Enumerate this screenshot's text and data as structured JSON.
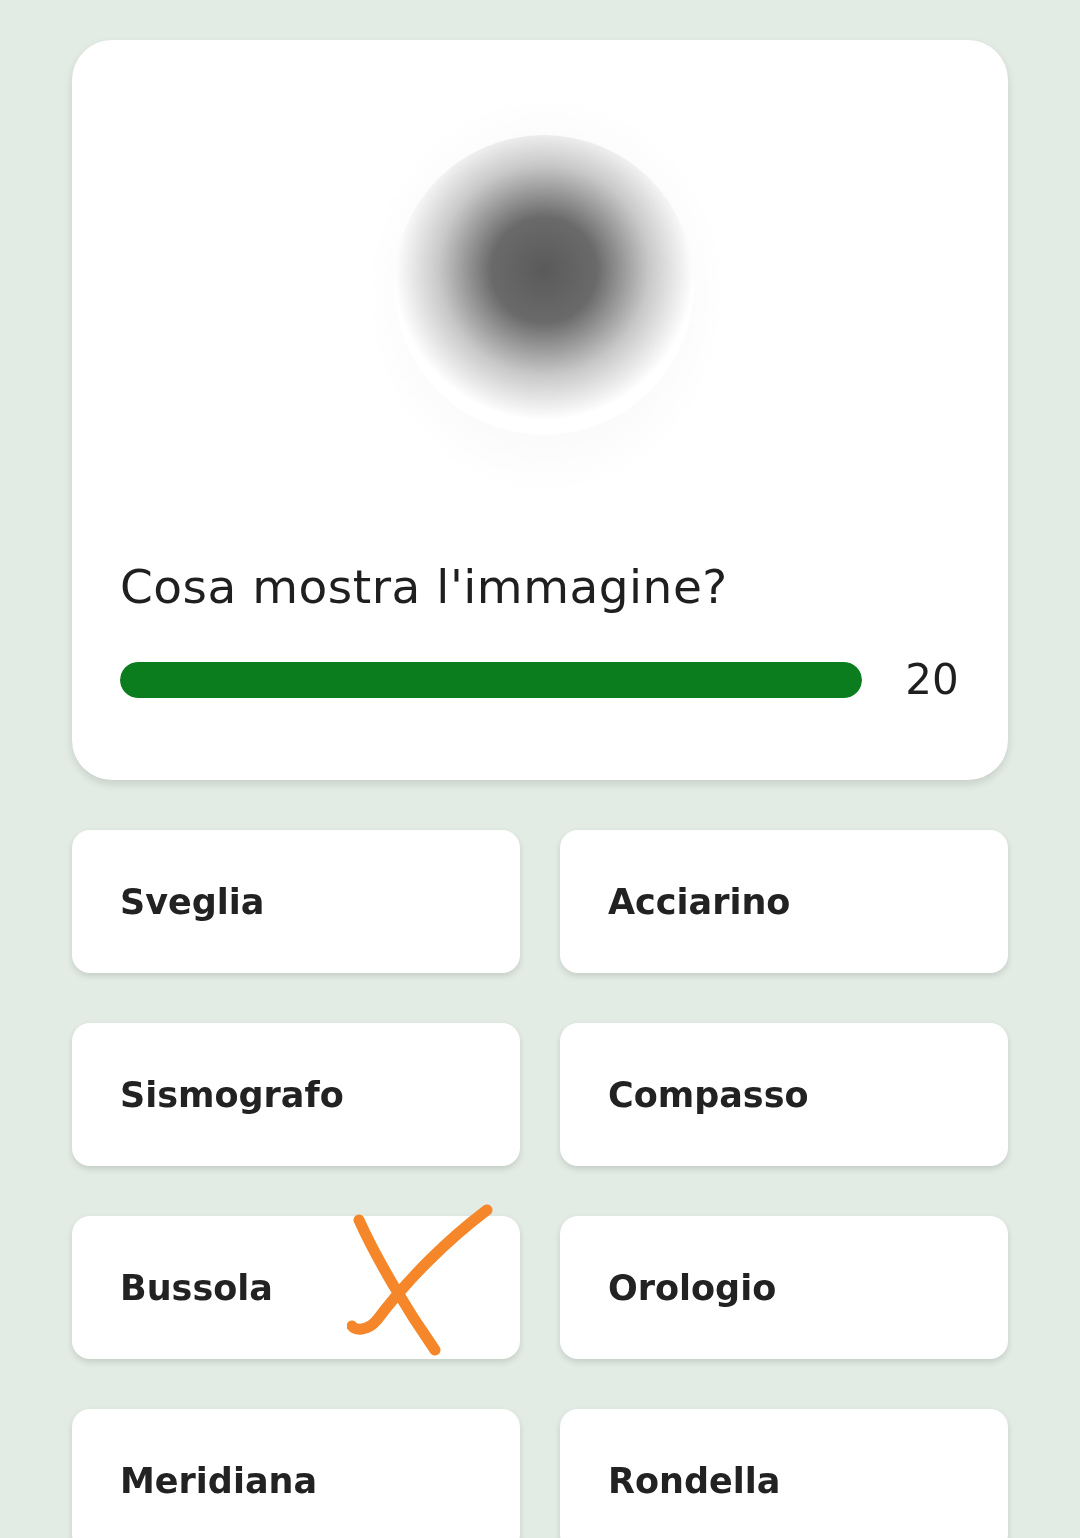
{
  "question": {
    "text": "Cosa mostra l'immagine?",
    "timer": {
      "level": 1,
      "reading": "20"
    }
  },
  "answers": [
    {
      "label": "Sveglia",
      "marked": false
    },
    {
      "label": "Acciarino",
      "marked": false
    },
    {
      "label": "Sismografo",
      "marked": false
    },
    {
      "label": "Compasso",
      "marked": false
    },
    {
      "label": "Bussola",
      "marked": true
    },
    {
      "label": "Orologio",
      "marked": false
    },
    {
      "label": "Meridiana",
      "marked": false
    },
    {
      "label": "Rondella",
      "marked": false
    }
  ]
}
